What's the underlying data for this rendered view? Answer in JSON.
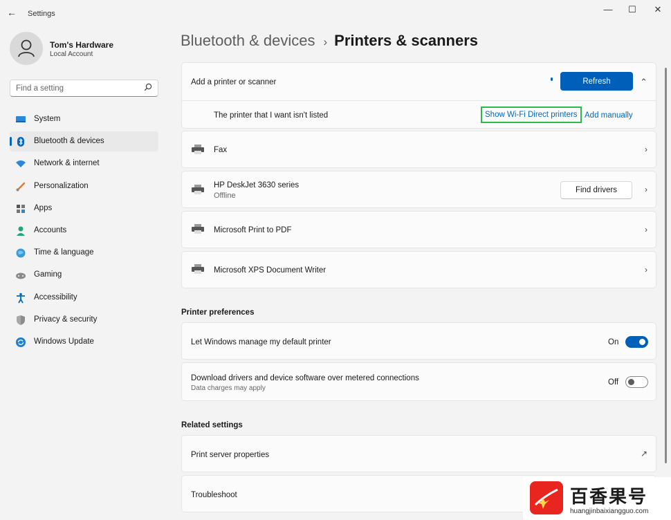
{
  "window": {
    "title": "Settings",
    "back_glyph": "←",
    "minimize_glyph": "—",
    "maximize_glyph": "☐",
    "close_glyph": "✕"
  },
  "profile": {
    "name": "Tom's Hardware",
    "account_type": "Local Account"
  },
  "search": {
    "placeholder": "Find a setting",
    "icon": "search-icon"
  },
  "nav": {
    "items": [
      {
        "label": "System",
        "icon": "system-icon",
        "active": false
      },
      {
        "label": "Bluetooth & devices",
        "icon": "bluetooth-icon",
        "active": true
      },
      {
        "label": "Network & internet",
        "icon": "wifi-icon",
        "active": false
      },
      {
        "label": "Personalization",
        "icon": "brush-icon",
        "active": false
      },
      {
        "label": "Apps",
        "icon": "apps-icon",
        "active": false
      },
      {
        "label": "Accounts",
        "icon": "person-icon",
        "active": false
      },
      {
        "label": "Time & language",
        "icon": "globe-icon",
        "active": false
      },
      {
        "label": "Gaming",
        "icon": "gamepad-icon",
        "active": false
      },
      {
        "label": "Accessibility",
        "icon": "accessibility-icon",
        "active": false
      },
      {
        "label": "Privacy & security",
        "icon": "shield-icon",
        "active": false
      },
      {
        "label": "Windows Update",
        "icon": "update-icon",
        "active": false
      }
    ]
  },
  "breadcrumb": {
    "parent": "Bluetooth & devices",
    "separator": "›",
    "current": "Printers & scanners"
  },
  "add_printer": {
    "label": "Add a printer or scanner",
    "refresh_label": "Refresh",
    "not_listed_label": "The printer that I want isn't listed",
    "wifi_direct_label": "Show Wi-Fi Direct printers",
    "add_manually_label": "Add manually",
    "chevron_up": "⌃"
  },
  "printers": [
    {
      "name": "Fax",
      "status": "",
      "icon": "printer-icon"
    },
    {
      "name": "HP DeskJet 3630 series",
      "status": "Offline",
      "icon": "printer-icon",
      "action_label": "Find drivers"
    },
    {
      "name": "Microsoft Print to PDF",
      "status": "",
      "icon": "printer-icon"
    },
    {
      "name": "Microsoft XPS Document Writer",
      "status": "",
      "icon": "printer-icon"
    }
  ],
  "chevron_right": "›",
  "preferences": {
    "title": "Printer preferences",
    "items": [
      {
        "label": "Let Windows manage my default printer",
        "description": "",
        "state_label": "On",
        "enabled": true
      },
      {
        "label": "Download drivers and device software over metered connections",
        "description": "Data charges may apply",
        "state_label": "Off",
        "enabled": false
      }
    ]
  },
  "related": {
    "title": "Related settings",
    "items": [
      {
        "label": "Print server properties",
        "icon": "external-link-icon",
        "glyph": "↗"
      },
      {
        "label": "Troubleshoot"
      }
    ]
  },
  "watermark": {
    "text": "百香果号",
    "url": "huangjinbaixiangguo.com"
  },
  "colors": {
    "accent": "#005fb8",
    "highlight_border": "#2db84d",
    "watermark_red": "#e8261f"
  }
}
